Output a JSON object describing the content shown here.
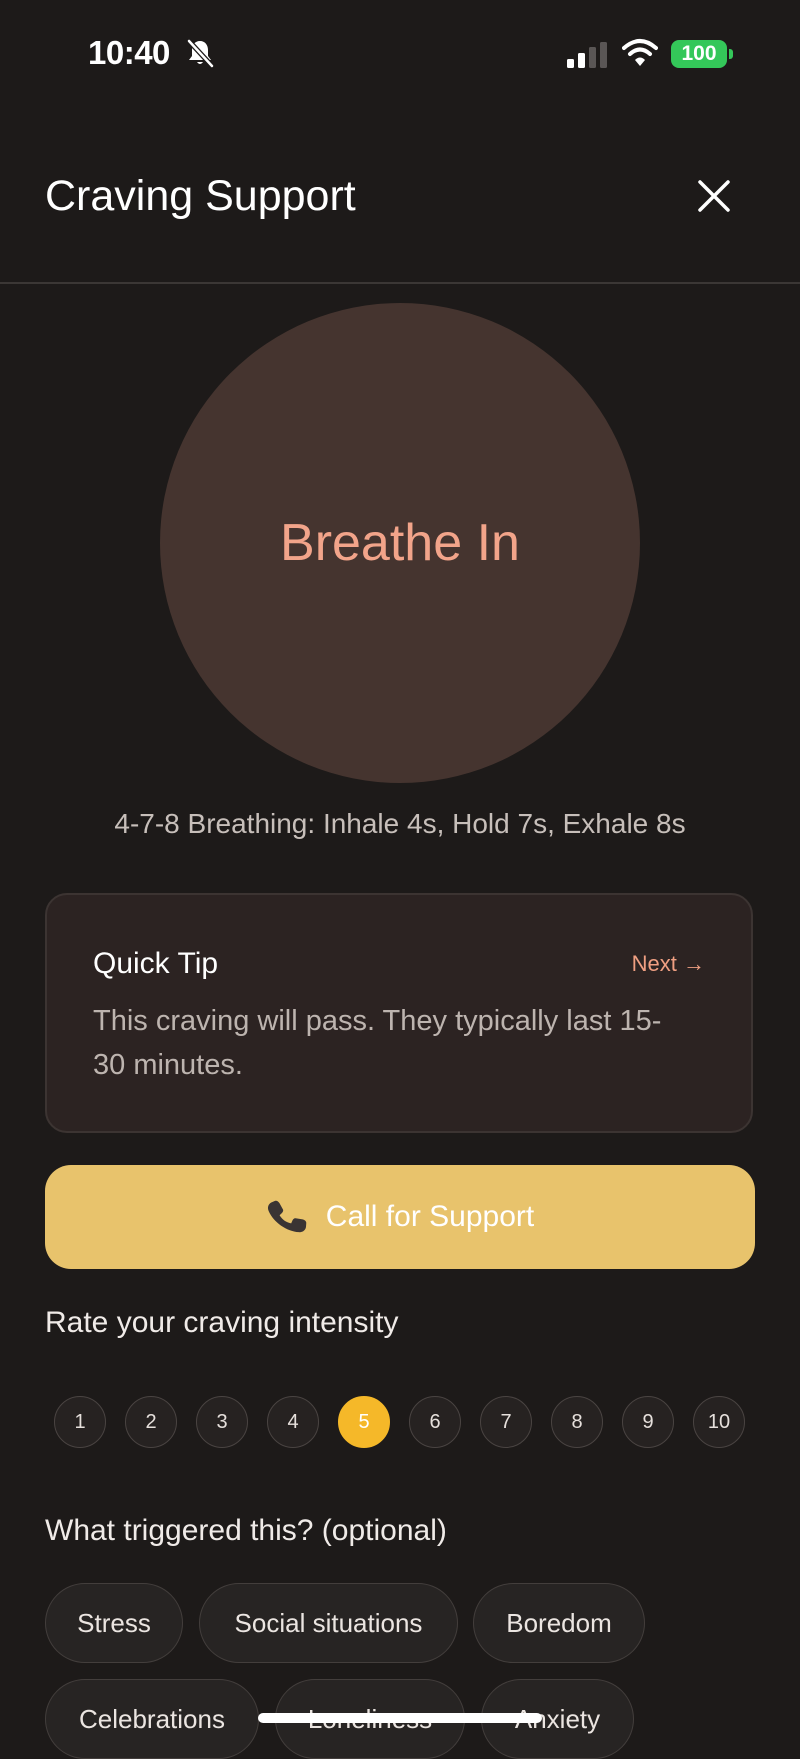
{
  "status_bar": {
    "time": "10:40",
    "battery": "100",
    "icons": [
      "bell-slash-icon",
      "signal-icon",
      "wifi-icon",
      "battery-icon"
    ]
  },
  "header": {
    "title": "Craving Support",
    "close_icon": "close-icon"
  },
  "breathing": {
    "phase": "Breathe In",
    "description": "4-7-8 Breathing: Inhale 4s, Hold 7s, Exhale 8s"
  },
  "tip": {
    "title": "Quick Tip",
    "next_label": "Next →",
    "body": "This craving will pass. They typically last 15-30 minutes."
  },
  "call_button": {
    "icon": "phone-icon",
    "label": "Call for Support"
  },
  "intensity": {
    "label": "Rate your craving intensity",
    "options": [
      "1",
      "2",
      "3",
      "4",
      "5",
      "6",
      "7",
      "8",
      "9",
      "10"
    ],
    "selected": "5"
  },
  "triggers": {
    "label": "What triggered this? (optional)",
    "options": [
      "Stress",
      "Social situations",
      "Boredom",
      "Celebrations",
      "Loneliness",
      "Anxiety"
    ]
  },
  "colors": {
    "background": "#1d1a19",
    "accent": "#e8c36c",
    "selected_rating": "#f5b829",
    "breath_text": "#f2a48a",
    "battery": "#34c759"
  }
}
